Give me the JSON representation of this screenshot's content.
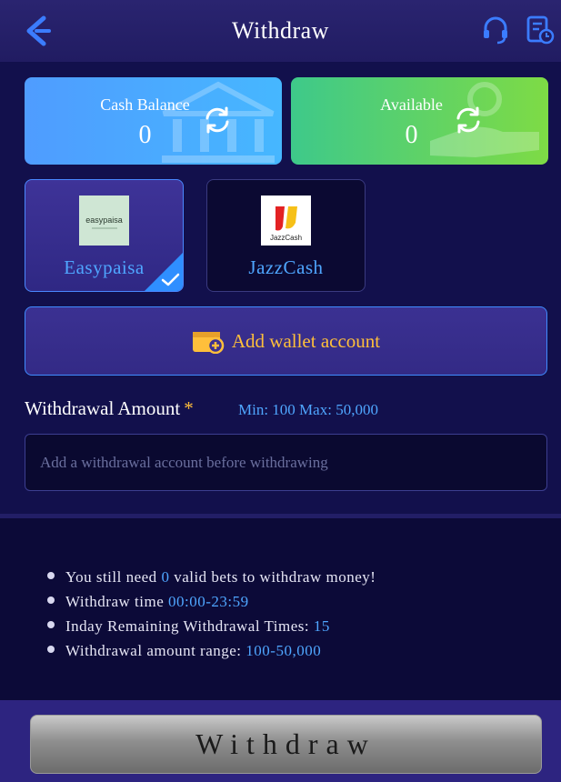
{
  "header": {
    "title": "Withdraw",
    "back_icon": "back-arrow-icon",
    "support_icon": "headset-icon",
    "record_icon": "record-list-icon"
  },
  "balances": [
    {
      "label": "Cash Balance",
      "value": "0",
      "icon": "bank-icon"
    },
    {
      "label": "Available",
      "value": "0",
      "icon": "hand-coin-icon"
    }
  ],
  "methods": [
    {
      "name": "Easypaisa",
      "logo_text": "easypaisa",
      "selected": true
    },
    {
      "name": "JazzCash",
      "logo_text": "JazzCash",
      "selected": false
    }
  ],
  "add_wallet": {
    "label": "Add wallet account"
  },
  "amount": {
    "label": "Withdrawal Amount",
    "required_mark": "*",
    "range": "Min: 100 Max: 50,000",
    "placeholder": "Add a withdrawal account before withdrawing"
  },
  "info": [
    {
      "pre": "You still need ",
      "hl": "0",
      "post": " valid bets to withdraw money!"
    },
    {
      "pre": "Withdraw time ",
      "hl": "00:00-23:59",
      "post": ""
    },
    {
      "pre": "Inday Remaining Withdrawal Times: ",
      "hl": "15",
      "post": ""
    },
    {
      "pre": "Withdrawal amount range: ",
      "hl": "100-50,000",
      "post": ""
    }
  ],
  "footer": {
    "button_label": "Withdraw"
  },
  "colors": {
    "accent_blue": "#4fa6ff",
    "accent_gold": "#ffbf3b",
    "background": "#12104c"
  }
}
